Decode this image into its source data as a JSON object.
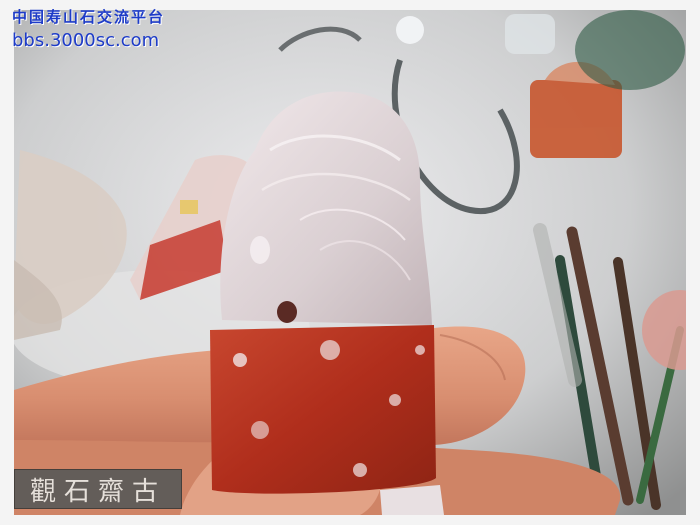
{
  "watermark": {
    "title": "中国寿山石交流平台",
    "url": "bbs.3000sc.com"
  },
  "stamp": {
    "text": "觀石齋古"
  },
  "colors": {
    "watermark_blue": "#1e3cc8",
    "stone_red": "#b8321f",
    "stone_white": "#e9dfe0",
    "background_gray": "#cfd0d2"
  }
}
